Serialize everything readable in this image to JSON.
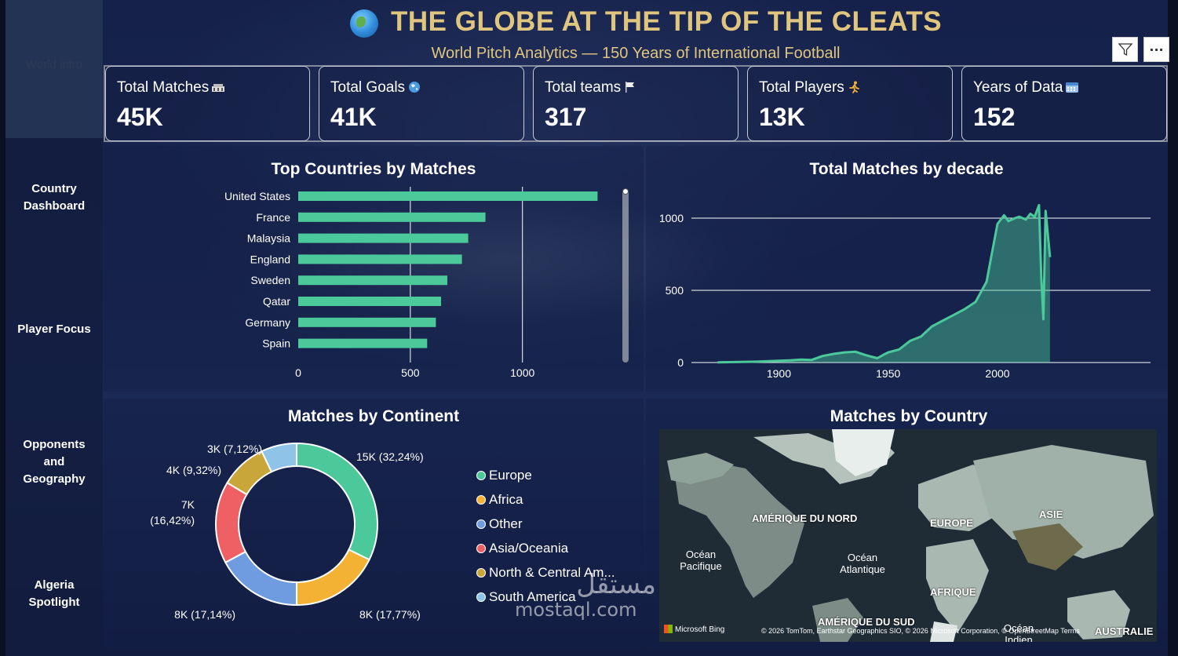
{
  "header": {
    "title": "THE GLOBE AT THE TIP OF THE CLEATS",
    "subtitle": "World Pitch Analytics — 150 Years of International Football"
  },
  "sidebar": {
    "items": [
      {
        "label": "World intro",
        "active": true
      },
      {
        "label": "Country Dashboard"
      },
      {
        "label": "Player Focus"
      },
      {
        "label": "Opponents and Geography"
      },
      {
        "label": "Algeria Spotlight"
      }
    ]
  },
  "visual_header": {
    "filter_icon": "filter-icon",
    "more_icon": "more-options-icon",
    "more_label": "···"
  },
  "kpis": [
    {
      "label": "Total Matches",
      "value": "45K",
      "icon": "stadium-icon"
    },
    {
      "label": "Total Goals",
      "value": "41K",
      "icon": "globe-icon"
    },
    {
      "label": "Total teams",
      "value": "317",
      "icon": "flag-icon"
    },
    {
      "label": "Total Players",
      "value": "13K",
      "icon": "runner-icon"
    },
    {
      "label": "Years of Data",
      "value": "152",
      "icon": "calendar-icon"
    }
  ],
  "colors": {
    "accent_gold": "#dfc57e",
    "bar_green": "#4cc99a",
    "europe": "#4cc99a",
    "africa": "#f3b234",
    "other": "#6f9ce0",
    "asia_oceania": "#ee6063",
    "north_central_america": "#c8a63a",
    "south_america": "#8fc4e8"
  },
  "chart_data": [
    {
      "type": "bar",
      "title": "Top Countries by Matches",
      "categories": [
        "United States",
        "France",
        "Malaysia",
        "England",
        "Sweden",
        "Qatar",
        "Germany",
        "Spain"
      ],
      "values": [
        1335,
        835,
        758,
        730,
        665,
        637,
        614,
        575
      ],
      "xticks": [
        "0",
        "500",
        "1000"
      ],
      "xlim": [
        0,
        1470
      ]
    },
    {
      "type": "area",
      "title": "Total Matches by decade",
      "x": [
        1872,
        1880,
        1890,
        1900,
        1905,
        1910,
        1915,
        1920,
        1925,
        1930,
        1935,
        1940,
        1945,
        1948,
        1950,
        1955,
        1960,
        1965,
        1970,
        1975,
        1980,
        1985,
        1990,
        1995,
        1997,
        2000,
        2003,
        2005,
        2008,
        2010,
        2013,
        2015,
        2017,
        2019,
        2020,
        2021,
        2022,
        2024
      ],
      "y": [
        1,
        3,
        6,
        12,
        15,
        20,
        18,
        45,
        60,
        70,
        75,
        50,
        30,
        55,
        70,
        90,
        150,
        180,
        250,
        290,
        330,
        370,
        420,
        560,
        720,
        960,
        1020,
        980,
        1000,
        1010,
        990,
        1030,
        1010,
        1090,
        600,
        300,
        1050,
        730
      ],
      "yticks": [
        "0",
        "500",
        "1000"
      ],
      "xticks": [
        "1900",
        "1950",
        "2000"
      ],
      "xlim": [
        1860,
        2070
      ],
      "ylim": [
        0,
        1000
      ]
    },
    {
      "type": "pie",
      "title": "Matches by Continent",
      "slices": [
        {
          "name": "Europe",
          "value": 32.24,
          "label": "15K (32,24%)"
        },
        {
          "name": "Africa",
          "value": 17.77,
          "label": "8K (17,77%)"
        },
        {
          "name": "Other",
          "value": 17.14,
          "label": "8K (17,14%)"
        },
        {
          "name": "Asia/Oceania",
          "value": 16.42,
          "label": "7K (16,42%)"
        },
        {
          "name": "North & Central Am...",
          "value": 9.32,
          "label": "4K (9,32%)"
        },
        {
          "name": "South America",
          "value": 7.12,
          "label": "3K (7,12%)"
        }
      ],
      "label_7k_a": "7K",
      "label_7k_b": "(16,42%)"
    }
  ],
  "map": {
    "title": "Matches by Country",
    "labels": [
      "AMÉRIQUE DU NORD",
      "EUROPE",
      "ASIE",
      "AFRIQUE",
      "AMÉRIQUE DU SUD",
      "AUSTRALIE"
    ],
    "oceans": [
      "Océan Pacifique",
      "Océan Atlantique",
      "Océan Indien"
    ],
    "bing": "Microsoft Bing",
    "attribution": "© 2026 TomTom, Earthstar Geographics SIO, © 2026 Microsoft Corporation, © OpenStreetMap Terms"
  },
  "watermark": {
    "arabic": "مستقل",
    "latin": "mostaql.com"
  }
}
